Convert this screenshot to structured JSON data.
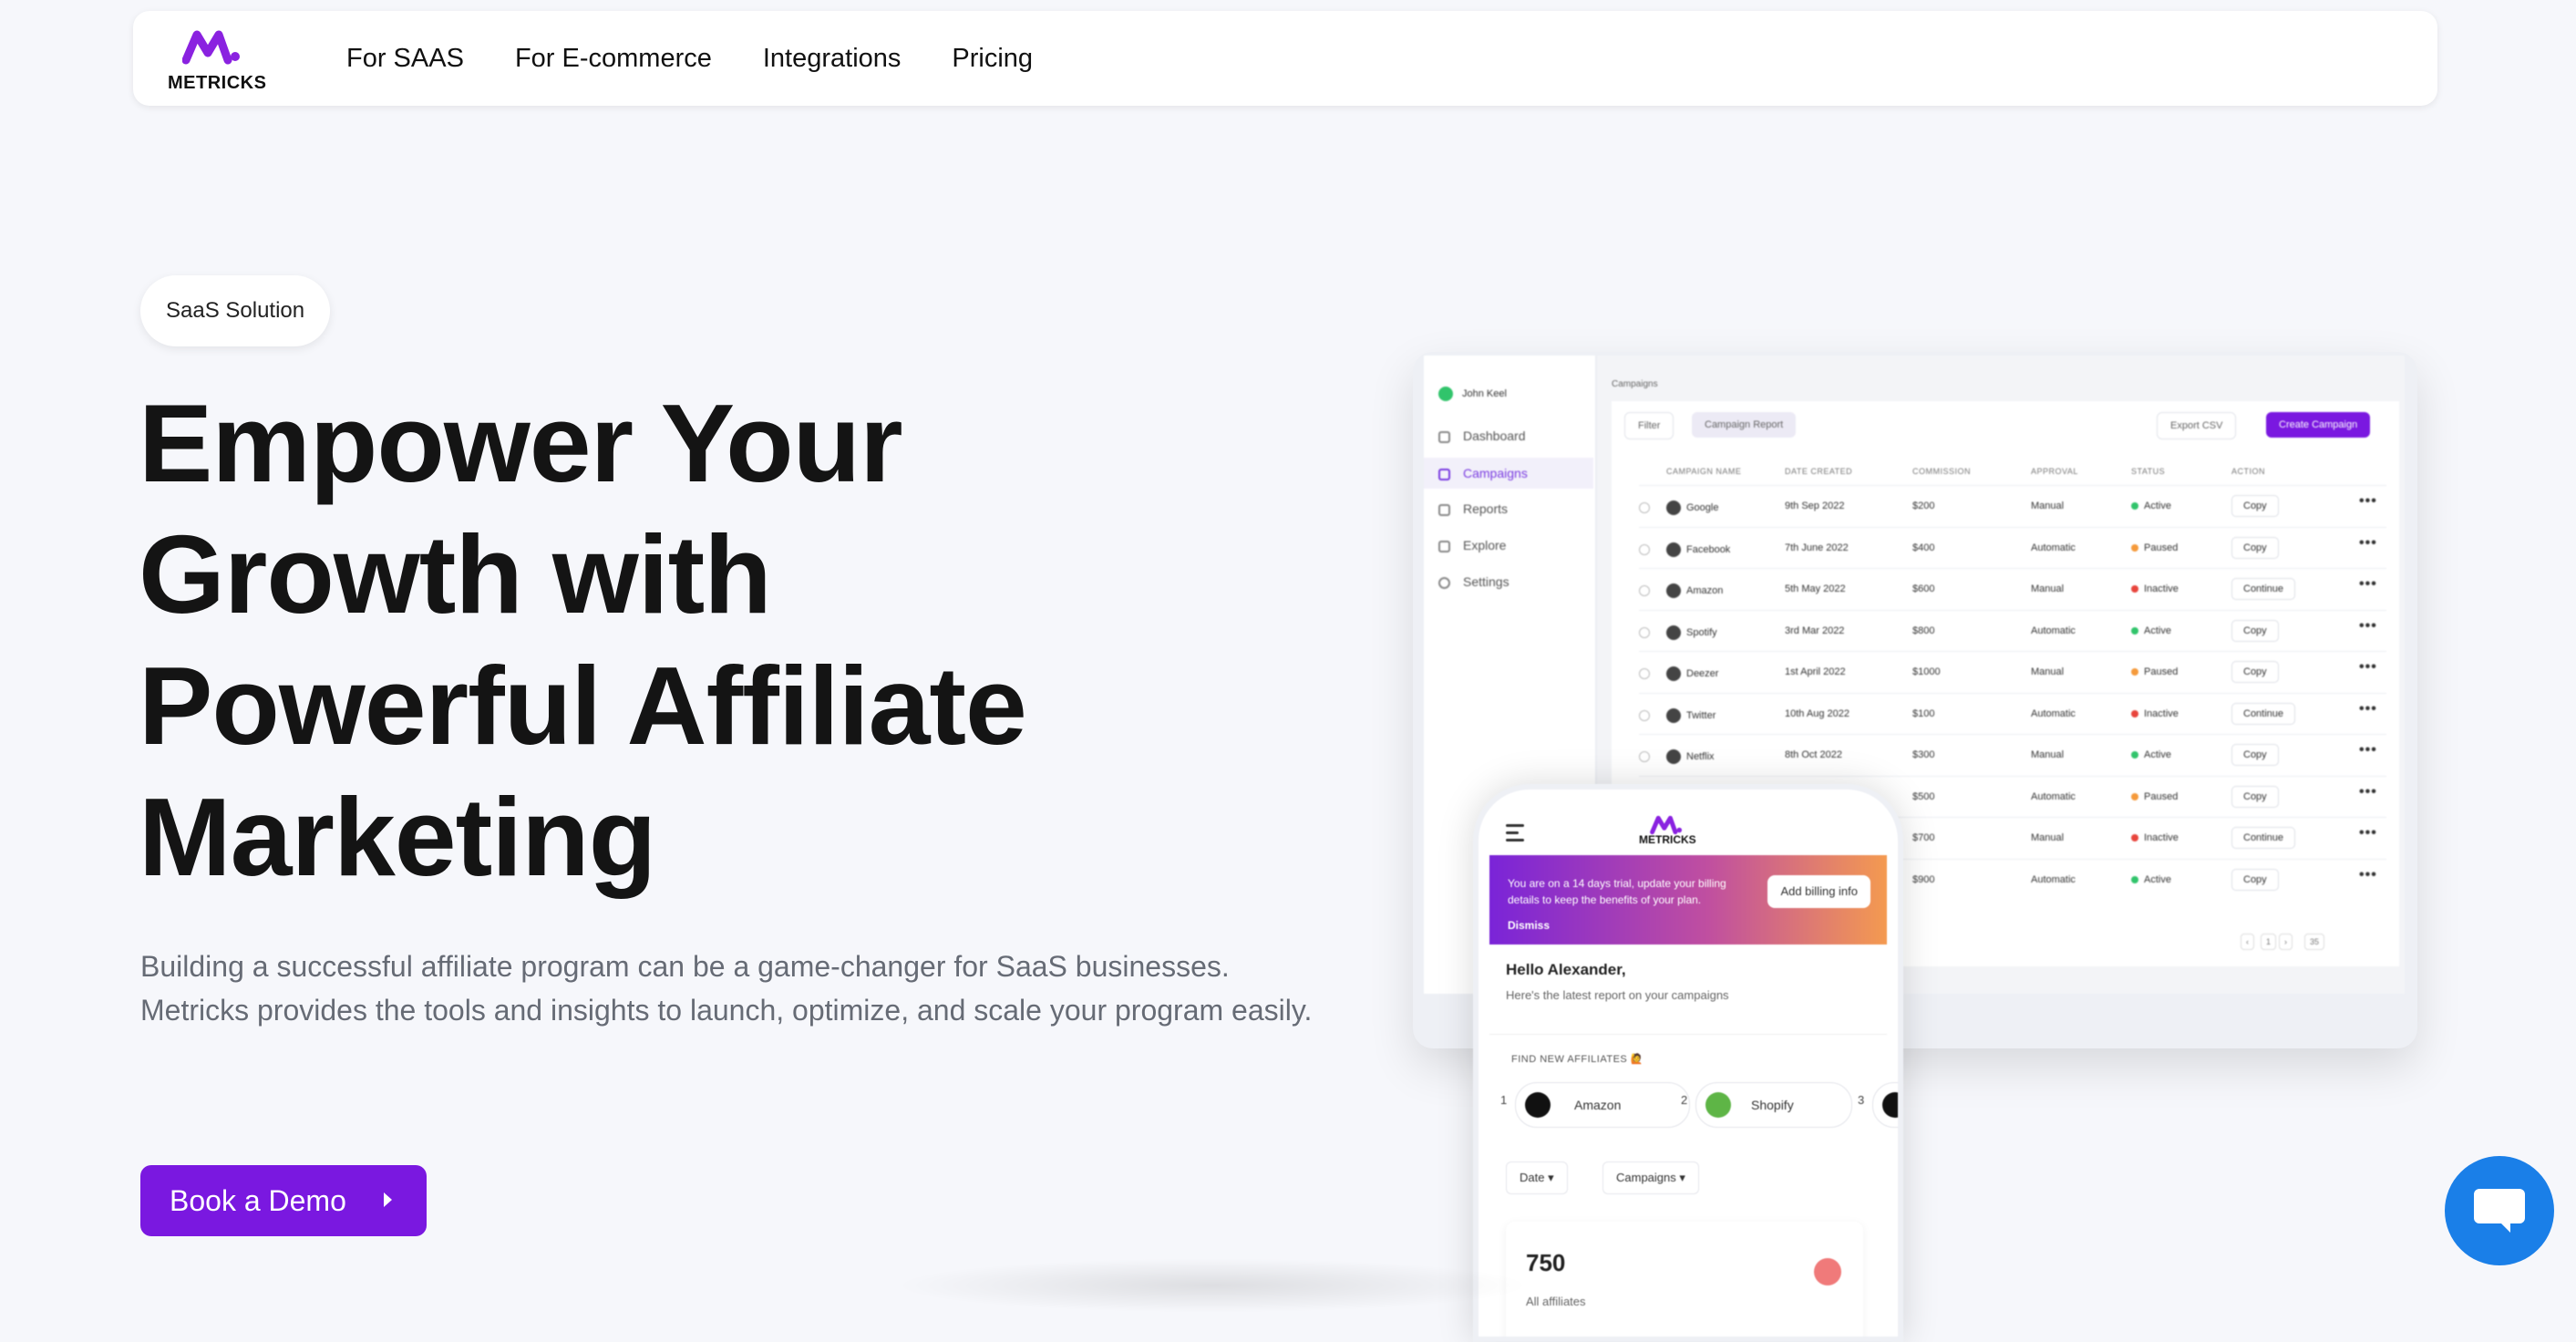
{
  "nav": {
    "logo_text": "METRICKS",
    "links": [
      "For SAAS",
      "For E-commerce",
      "Integrations",
      "Pricing"
    ]
  },
  "hero": {
    "badge": "SaaS Solution",
    "headline_lines": [
      "Empower Your",
      "Growth with",
      "Powerful Affiliate",
      "Marketing"
    ],
    "subtext": "Building a successful affiliate program can be a game-changer for SaaS businesses. Metricks provides the tools and insights to launch, optimize, and scale your program easily.",
    "cta": "Book a Demo"
  },
  "desktop": {
    "user_name": "John Keel",
    "sidebar": [
      "Dashboard",
      "Campaigns",
      "Reports",
      "Explore",
      "Settings"
    ],
    "breadcrumb": "Campaigns",
    "filter": "Filter",
    "report": "Campaign Report",
    "export": "Export CSV",
    "create": "Create Campaign",
    "columns": [
      "CAMPAIGN NAME",
      "DATE CREATED",
      "COMMISSION",
      "APPROVAL",
      "STATUS",
      "ACTION"
    ],
    "rows": [
      {
        "name": "Google",
        "date": "9th Sep 2022",
        "commission": "$200",
        "approval": "Manual",
        "status": "Active",
        "action": "Copy"
      },
      {
        "name": "Facebook",
        "date": "7th June 2022",
        "commission": "$400",
        "approval": "Automatic",
        "status": "Paused",
        "action": "Copy"
      },
      {
        "name": "Amazon",
        "date": "5th May 2022",
        "commission": "$600",
        "approval": "Manual",
        "status": "Inactive",
        "action": "Continue"
      },
      {
        "name": "Spotify",
        "date": "3rd Mar 2022",
        "commission": "$800",
        "approval": "Automatic",
        "status": "Active",
        "action": "Copy"
      },
      {
        "name": "Deezer",
        "date": "1st April 2022",
        "commission": "$1000",
        "approval": "Manual",
        "status": "Paused",
        "action": "Copy"
      },
      {
        "name": "Twitter",
        "date": "10th Aug 2022",
        "commission": "$100",
        "approval": "Automatic",
        "status": "Inactive",
        "action": "Continue"
      },
      {
        "name": "Netflix",
        "date": "8th Oct 2022",
        "commission": "$300",
        "approval": "Manual",
        "status": "Active",
        "action": "Copy"
      },
      {
        "name": "",
        "date": "",
        "commission": "$500",
        "approval": "Automatic",
        "status": "Paused",
        "action": "Copy"
      },
      {
        "name": "",
        "date": "",
        "commission": "$700",
        "approval": "Manual",
        "status": "Inactive",
        "action": "Continue"
      },
      {
        "name": "",
        "date": "",
        "commission": "$900",
        "approval": "Automatic",
        "status": "Active",
        "action": "Copy"
      }
    ],
    "pager_page": "1",
    "pager_size": "35"
  },
  "phone": {
    "logo_text": "METRICKS",
    "banner_text": "You are on a 14 days trial, update your billing details to keep the benefits of your plan.",
    "banner_dismiss": "Dismiss",
    "billing_button": "Add billing info",
    "hello": "Hello Alexander,",
    "hello_sub": "Here's the latest report on your campaigns",
    "find_title": "FIND NEW AFFILIATES 🙋",
    "affiliates": [
      {
        "num": "1",
        "name": "Amazon"
      },
      {
        "num": "2",
        "name": "Shopify"
      },
      {
        "num": "3",
        "name": ""
      }
    ],
    "filter_date": "Date",
    "filter_campaigns": "Campaigns",
    "stat_value": "750",
    "stat_label": "All affiliates"
  },
  "colors": {
    "brand": "#7a18e0",
    "active": "#31c46b",
    "paused": "#f59a3b",
    "inactive": "#e8453c",
    "chat": "#1a7fe8"
  }
}
